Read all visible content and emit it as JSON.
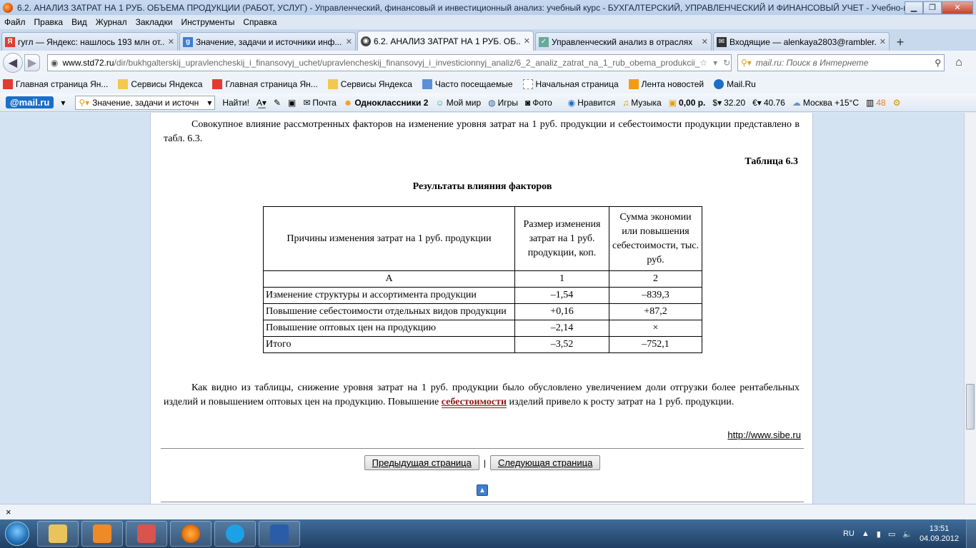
{
  "window": {
    "title": "6.2. АНАЛИЗ ЗАТРАТ НА 1 РУБ. ОБЪЕМА ПРОДУКЦИИ (РАБОТ, УСЛУГ) - Управленческий, финансовый и инвестиционный анализ: учебный курс - БУХГАЛТЕРСКИЙ, УПРАВЛЕНЧЕСКИЙ И ФИНАНСОВЫЙ УЧЕТ - Учебно-мет..."
  },
  "menu": [
    "Файл",
    "Правка",
    "Вид",
    "Журнал",
    "Закладки",
    "Инструменты",
    "Справка"
  ],
  "tabs": [
    {
      "label": "гугл — Яндекс: нашлось 193 млн от...",
      "icon_color": "#e43a2f",
      "icon_char": "Я"
    },
    {
      "label": "Значение, задачи и источники инф...",
      "icon_color": "#3b7dd8",
      "icon_char": "g"
    },
    {
      "label": "6.2. АНАЛИЗ ЗАТРАТ НА 1 РУБ. ОБ...",
      "icon_color": "#444",
      "icon_char": "◉"
    },
    {
      "label": "Управленческий анализ в отраслях",
      "icon_color": "#6a9",
      "icon_char": "✓"
    },
    {
      "label": "Входящие — alenkaya2803@rambler....",
      "icon_color": "#333",
      "icon_char": "✉"
    }
  ],
  "nav": {
    "url_site": "www.std72.ru",
    "url_path": "/dir/bukhgalterskij_upravlencheskij_i_finansovyj_uchet/upravlencheskij_finansovyj_i_investicionnyj_analiz/6_2_analiz_zatrat_na_1_rub_obema_produkcii_",
    "search_placeholder": "mail.ru: Поиск в Интернете"
  },
  "bookmarks": [
    {
      "label": "Главная страница Ян...",
      "icon_color": "#e43a2f"
    },
    {
      "label": "Сервисы Яндекса",
      "icon_color": "#f2c94c"
    },
    {
      "label": "Главная страница Ян...",
      "icon_color": "#e43a2f"
    },
    {
      "label": "Сервисы Яндекса",
      "icon_color": "#f2c94c"
    },
    {
      "label": "Часто посещаемые",
      "icon_color": "#5b8fd6"
    },
    {
      "label": "Начальная страница",
      "icon_color": "#ffffff"
    },
    {
      "label": "Лента новостей",
      "icon_color": "#f39c12"
    },
    {
      "label": "Mail.Ru",
      "icon_color": "#1a6fc8"
    }
  ],
  "mailbar": {
    "logo": "@mail.ru",
    "search_value": "Значение, задачи и источн",
    "find_label": "Найти!",
    "items": [
      {
        "label": "Почта"
      },
      {
        "label": "Одноклассники 2"
      },
      {
        "label": "Мой мир"
      },
      {
        "label": "Игры"
      },
      {
        "label": "Фото"
      },
      {
        "label": "Нравится"
      },
      {
        "label": "Музыка"
      },
      {
        "label": "0,00 р."
      },
      {
        "label": "32.20"
      },
      {
        "label": "40.76"
      },
      {
        "label": "Москва +15°C"
      },
      {
        "label": "48"
      }
    ]
  },
  "article": {
    "intro": "Совокупное влияние рассмотренных факторов на изменение уровня затрат на 1 руб. продукции и себестоимости продукции представлено в табл. 6.3.",
    "table_number": "Таблица 6.3",
    "table_caption": "Результаты влияния факторов",
    "table": {
      "headers": [
        "Причины изменения затрат на 1 руб. продукции",
        "Размер изменения затрат на 1 руб. продукции, коп.",
        "Сумма экономии или повышения себестоимости, тыс. руб."
      ],
      "index_row": [
        "А",
        "1",
        "2"
      ],
      "rows": [
        [
          "Изменение структуры и ассортимента продукции",
          "–1,54",
          "–839,3"
        ],
        [
          "Повышение себестоимости отдельных видов продукции",
          "+0,16",
          "+87,2"
        ],
        [
          "Повышение оптовых цен на продукцию",
          "–2,14",
          "×"
        ],
        [
          "Итого",
          "–3,52",
          "–752,1"
        ]
      ]
    },
    "conclusion_before": "Как видно из таблицы, снижение уровня затрат на 1 руб. продукции было обусловлено увеличением доли отгрузки более рентабельных изделий и повышением оптовых цен на продукцию. Повышение ",
    "conclusion_link": "себестоимости",
    "conclusion_after": " изделий привело к росту затрат на 1 руб. продукции.",
    "source": "http://www.sibe.ru",
    "prev_label": "Предыдущая страница",
    "next_label": "Следующая страница",
    "separator": "|"
  },
  "findbar": {
    "close": "×"
  },
  "taskbar": {
    "apps": [
      {
        "name": "explorer",
        "color": "#e9c45a"
      },
      {
        "name": "media-player",
        "color": "#f08a24"
      },
      {
        "name": "app",
        "color": "#d9534f"
      },
      {
        "name": "firefox",
        "color": "#e8740c"
      },
      {
        "name": "skype",
        "color": "#1ea0e6"
      },
      {
        "name": "word",
        "color": "#2a5caa"
      }
    ],
    "lang": "RU",
    "time": "13:51",
    "date": "04.09.2012"
  }
}
